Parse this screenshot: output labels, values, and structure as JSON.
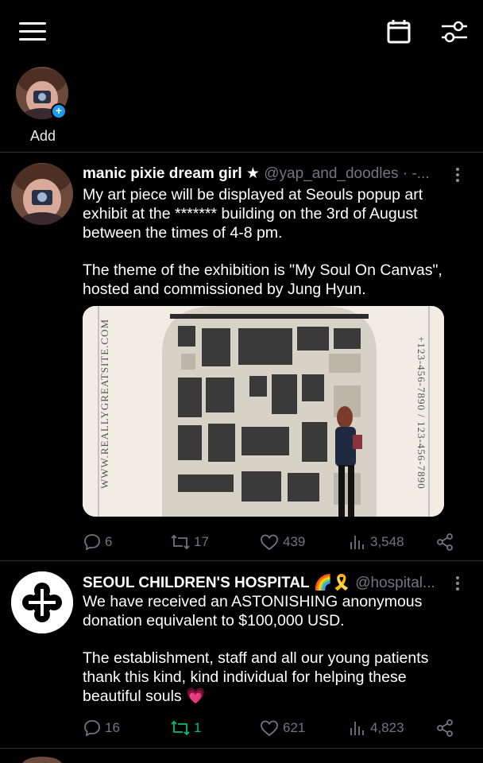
{
  "stories": {
    "add_label": "Add"
  },
  "posts": [
    {
      "name": "manic pixie dream girl ★",
      "handle": "@yap_and_doodles · -...",
      "body": [
        "My art piece will be displayed at Seouls popup art exhibit at the ******* building on the 3rd of August between the times of 4-8 pm.",
        "The theme of the exhibition is \"My Soul On Canvas\", hosted and commissioned by Jung Hyun."
      ],
      "media": {
        "side_left": "WWW.REALLYGREATSITE.COM",
        "side_right": "+123-456-7890 / 123-456-7890"
      },
      "stats": {
        "replies": "6",
        "reposts": "17",
        "likes": "439",
        "views": "3,548"
      }
    },
    {
      "name": "SEOUL CHILDREN'S HOSPITAL 🌈🎗️",
      "handle": "@hospital...",
      "body": [
        "We have received an ASTONISHING anonymous donation equivalent to $100,000 USD.",
        "The establishment, staff and all our young patients thank this kind, kind individual for helping these beautiful souls 💗"
      ],
      "stats": {
        "replies": "16",
        "reposts": "1",
        "likes": "621",
        "views": "4,823"
      }
    }
  ],
  "colors": {
    "background": "#000000",
    "accent": "#1d9bf0",
    "repost_active": "#00ba7c",
    "muted": "#71767b"
  },
  "icons": [
    "menu-icon",
    "calendar-icon",
    "filter-icon",
    "reply-icon",
    "repost-icon",
    "like-icon",
    "views-icon",
    "share-icon",
    "more-icon"
  ]
}
